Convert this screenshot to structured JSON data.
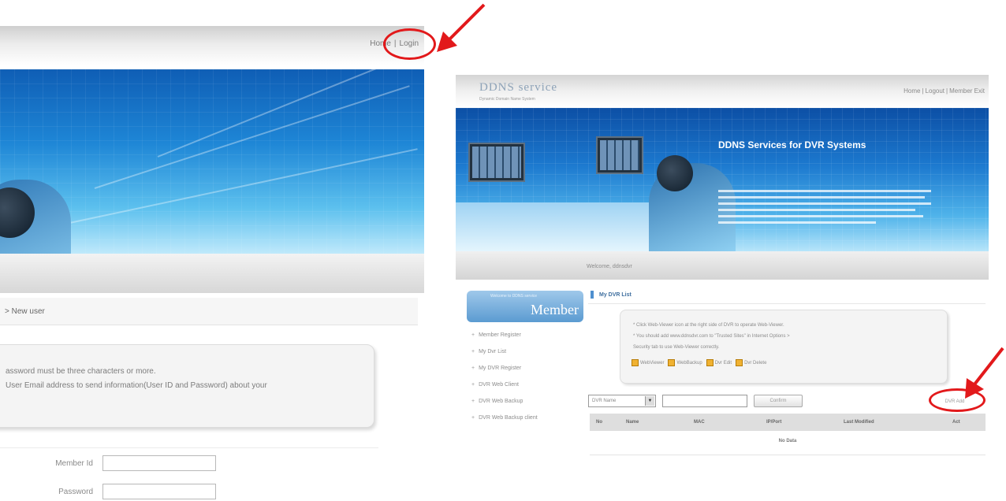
{
  "colors": {
    "annotation_red": "#e2191b",
    "hero_blue": "#1c79cf",
    "member_blue": "#5b9bd1"
  },
  "left_panel": {
    "topnav": {
      "home": "Home",
      "separator": "|",
      "login": "Login"
    },
    "section_title": "> New user",
    "notice_lines": [
      "assword must be three characters or more.",
      "User Email address to send information(User ID and Password) about your"
    ],
    "form": {
      "member_id_label": "Member Id",
      "password_label": "Password"
    }
  },
  "right_panel": {
    "logo": {
      "title": "DDNS service",
      "subtitle": "Dynamic Domain Name System"
    },
    "topnav": {
      "home": "Home",
      "logout": "Logout",
      "member_exit": "Member Exit",
      "separator": "|"
    },
    "hero": {
      "title": "DDNS Services for DVR Systems"
    },
    "welcome": "Welcome, ddnsdvr",
    "sidebar": {
      "member_small": "Welcome to DDNS service",
      "member_title": "Member",
      "items": [
        "Member Register",
        "My Dvr List",
        "My DVR Register",
        "DVR Web Client",
        "DVR Web Backup",
        "DVR Web Backup client"
      ]
    },
    "main": {
      "title": "My DVR List",
      "info_lines": [
        "* Click Web-Viewer icon at the right side of DVR to operate Web-Viewer.",
        "* You should add www.ddnsdvr.com to \"Trusted Sites\" in Internet Options >",
        "  Security tab to use Web-Viewer correctly."
      ],
      "legend": {
        "web_viewer": "WebViewer",
        "web_backup": "WebBackup",
        "dvr_edit": "Dvr Edit",
        "dvr_delete": "Dvr Delete"
      },
      "search": {
        "select_value": "DVR Name",
        "confirm_label": "Confirm",
        "add_label": "DVR Add"
      },
      "table": {
        "columns": [
          "No",
          "Name",
          "MAC",
          "IP/Port",
          "Last Modified",
          "Act"
        ],
        "empty_text": "No Data"
      }
    }
  }
}
